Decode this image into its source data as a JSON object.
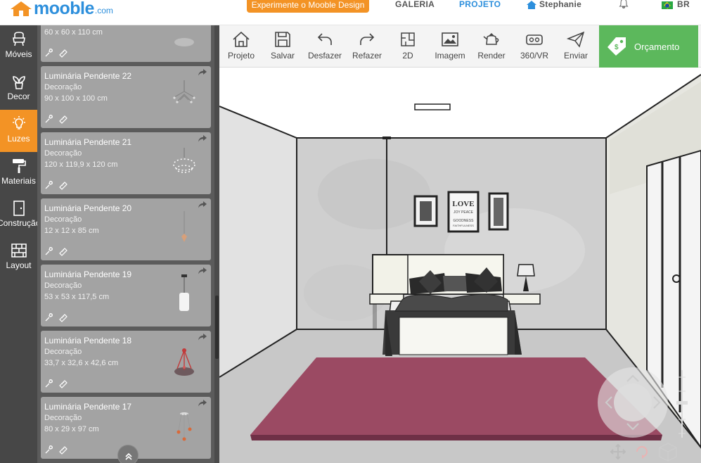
{
  "header": {
    "brand": "mooble",
    "brand_suffix": ".com",
    "promo_label": "Experimente o Mooble Design",
    "nav": {
      "galeria": "GALERIA",
      "projeto": "PROJETO",
      "user": "Stephanie",
      "lang": "BR"
    }
  },
  "sidebar": {
    "items": [
      {
        "label": "Móveis",
        "icon": "armchair-icon"
      },
      {
        "label": "Decor",
        "icon": "plant-icon"
      },
      {
        "label": "Luzes",
        "icon": "bulb-icon",
        "active": true
      },
      {
        "label": "Materiais",
        "icon": "paint-roller-icon"
      },
      {
        "label": "Construção",
        "icon": "door-icon"
      },
      {
        "label": "Layout",
        "icon": "brick-wall-icon"
      }
    ]
  },
  "catalog": {
    "top_partial_dim": "60 x 60 x 110 cm",
    "items": [
      {
        "name": "Luminária Pendente 22",
        "category": "Decoração",
        "dimensions": "90 x 100 x 100 cm"
      },
      {
        "name": "Luminária Pendente 21",
        "category": "Decoração",
        "dimensions": "120 x 119,9 x 120 cm"
      },
      {
        "name": "Luminária Pendente 20",
        "category": "Decoração",
        "dimensions": "12 x 12 x 85 cm"
      },
      {
        "name": "Luminária Pendente 19",
        "category": "Decoração",
        "dimensions": "53 x 53 x 117,5 cm"
      },
      {
        "name": "Luminária Pendente 18",
        "category": "Decoração",
        "dimensions": "33,7 x 32,6 x 42,6 cm"
      },
      {
        "name": "Luminária Pendente 17",
        "category": "Decoração",
        "dimensions": "80 x 29 x 97 cm"
      }
    ]
  },
  "toolbar": {
    "projeto": "Projeto",
    "salvar": "Salvar",
    "desfazer": "Desfazer",
    "refazer": "Refazer",
    "view2d": "2D",
    "imagem": "Imagem",
    "render": "Render",
    "vr": "360/VR",
    "enviar": "Enviar",
    "orcamento": "Orçamento"
  },
  "scene": {
    "poster_lines": [
      "LOVE",
      "JOY PEACE",
      "GOODNESS",
      "FAITHFULNESS"
    ]
  },
  "colors": {
    "accent_orange": "#f39325",
    "brand_blue": "#2d8fdc",
    "budget_green": "#5cb85c",
    "rug": "#9b4a63"
  }
}
